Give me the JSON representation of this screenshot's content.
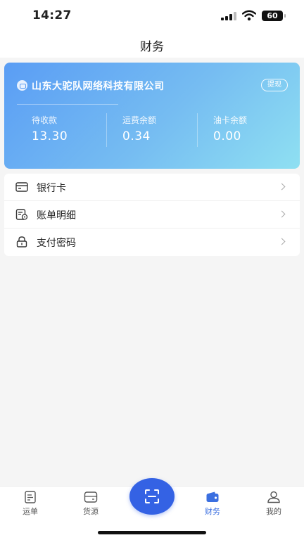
{
  "status_bar": {
    "time": "14:27",
    "battery": "60"
  },
  "header": {
    "title": "财务"
  },
  "account": {
    "company_name": "山东大驼队网络科技有限公司",
    "withdraw_label": "提现",
    "balances": [
      {
        "label": "待收款",
        "value": "13.30"
      },
      {
        "label": "运费余额",
        "value": "0.34"
      },
      {
        "label": "油卡余额",
        "value": "0.00"
      }
    ]
  },
  "menu": {
    "items": [
      {
        "label": "银行卡",
        "icon": "bank-card-icon"
      },
      {
        "label": "账单明细",
        "icon": "bill-detail-icon"
      },
      {
        "label": "支付密码",
        "icon": "lock-icon"
      }
    ]
  },
  "tabs": [
    {
      "label": "运单",
      "icon": "waybill-icon"
    },
    {
      "label": "货源",
      "icon": "cargo-source-icon"
    },
    {
      "label": "财务",
      "icon": "wallet-icon",
      "active": true
    },
    {
      "label": "我的",
      "icon": "profile-icon"
    }
  ],
  "scan": {
    "icon": "scan-icon"
  },
  "colors": {
    "accent": "#3462e4",
    "active_tab": "#3b6fe0",
    "card_start": "#5a9df4",
    "card_end": "#8fe0f2"
  }
}
